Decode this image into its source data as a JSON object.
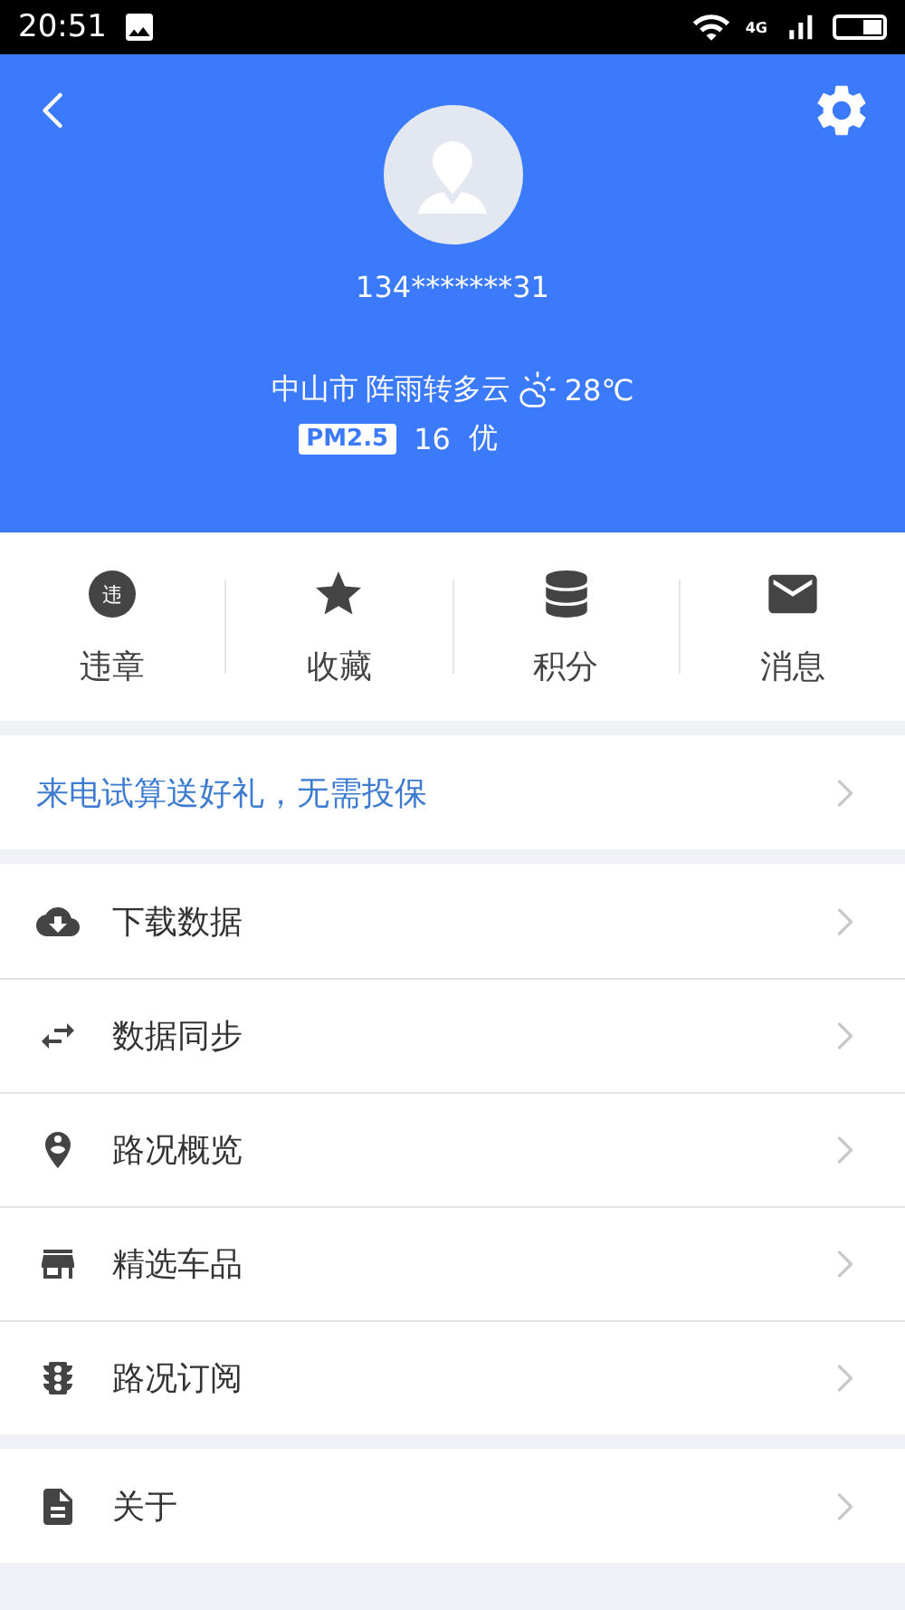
{
  "status_bar": {
    "time": "20:51",
    "network": "4G"
  },
  "header": {
    "phone": "134*******31",
    "weather": {
      "city": "中山市",
      "condition": "阵雨转多云",
      "temperature": "28℃"
    },
    "air": {
      "label": "PM2.5",
      "value": "16",
      "quality": "优"
    }
  },
  "shortcuts": [
    {
      "kind": "violation",
      "label": "违章",
      "badge": "违"
    },
    {
      "kind": "favorites",
      "label": "收藏"
    },
    {
      "kind": "points",
      "label": "积分"
    },
    {
      "kind": "messages",
      "label": "消息"
    }
  ],
  "promo": {
    "text": "来电试算送好礼，无需投保"
  },
  "menu": [
    {
      "kind": "download",
      "label": "下载数据"
    },
    {
      "kind": "sync",
      "label": "数据同步"
    },
    {
      "kind": "traffic-map",
      "label": "路况概览"
    },
    {
      "kind": "store",
      "label": "精选车品"
    },
    {
      "kind": "traffic-light",
      "label": "路况订阅"
    }
  ],
  "about": {
    "kind": "document",
    "label": "关于"
  }
}
